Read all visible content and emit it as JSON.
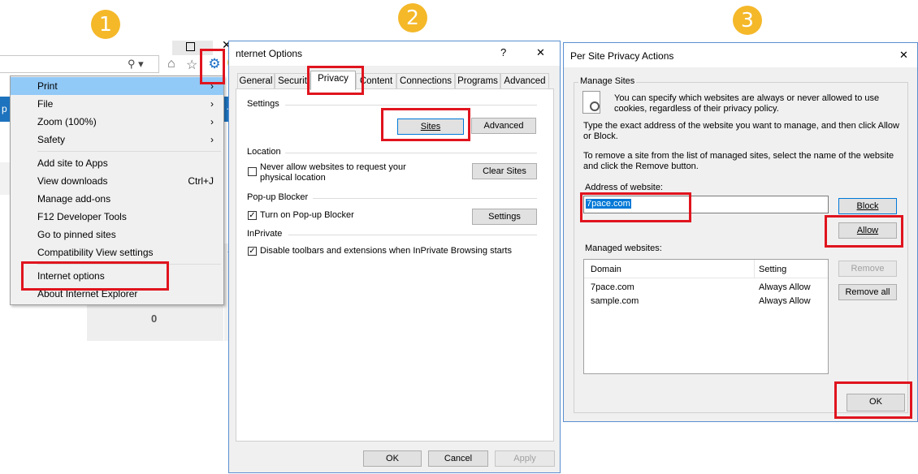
{
  "steps": [
    "1",
    "2",
    "3"
  ],
  "panel1": {
    "search_icon": "search-icon",
    "tools_icon": "gear-icon",
    "counter": "0",
    "menu": {
      "items": [
        {
          "label": "Print",
          "shortcut": "",
          "arrow": "›"
        },
        {
          "label": "File",
          "shortcut": "",
          "arrow": "›"
        },
        {
          "label": "Zoom (100%)",
          "shortcut": "",
          "arrow": "›"
        },
        {
          "label": "Safety",
          "shortcut": "",
          "arrow": "›"
        },
        {
          "label": "Add site to Apps",
          "shortcut": ""
        },
        {
          "label": "View downloads",
          "shortcut": "Ctrl+J"
        },
        {
          "label": "Manage add-ons",
          "shortcut": ""
        },
        {
          "label": "F12 Developer Tools",
          "shortcut": ""
        },
        {
          "label": "Go to pinned sites",
          "shortcut": ""
        },
        {
          "label": "Compatibility View settings",
          "shortcut": ""
        },
        {
          "label": "Internet options",
          "shortcut": ""
        },
        {
          "label": "About Internet Explorer",
          "shortcut": ""
        }
      ]
    }
  },
  "panel2": {
    "title": "nternet Options",
    "help": "?",
    "close": "✕",
    "tabs": [
      "General",
      "Securit",
      "Privacy",
      "Content",
      "Connections",
      "Programs",
      "Advanced"
    ],
    "settings": {
      "header": "Settings",
      "sites_button": "Sites",
      "advanced_button": "Advanced"
    },
    "location": {
      "header": "Location",
      "checkbox_label_1": "Never allow websites to request your",
      "checkbox_label_2": "physical location",
      "checked": false,
      "clear_sites_button": "Clear Sites"
    },
    "popup": {
      "header": "Pop-up Blocker",
      "checkbox_label": "Turn on Pop-up Blocker",
      "checked": true,
      "settings_button": "Settings"
    },
    "inprivate": {
      "header": "InPrivate",
      "checkbox_label": "Disable toolbars and extensions when InPrivate Browsing starts",
      "checked": true
    },
    "footer": {
      "ok": "OK",
      "cancel": "Cancel",
      "apply": "Apply"
    }
  },
  "panel3": {
    "title": "Per Site Privacy Actions",
    "close": "✕",
    "group_title": "Manage Sites",
    "intro_1": "You can specify which websites are always or never allowed to use",
    "intro_2": "cookies, regardless of their privacy policy.",
    "instr_1a": "Type the exact address of the website you want to manage, and then click Allow",
    "instr_1b": "or Block.",
    "instr_2a": "To remove a site from the list of managed sites, select the name of the website",
    "instr_2b": "and click the Remove button.",
    "address_label": "Address of website:",
    "address_value": "7pace.com",
    "block_button": "Block",
    "allow_button": "Allow",
    "managed_label": "Managed websites:",
    "columns": [
      "Domain",
      "Setting"
    ],
    "rows": [
      {
        "domain": "7pace.com",
        "setting": "Always Allow"
      },
      {
        "domain": "sample.com",
        "setting": "Always Allow"
      }
    ],
    "remove_button": "Remove",
    "remove_all_button": "Remove all",
    "ok_button": "OK"
  }
}
